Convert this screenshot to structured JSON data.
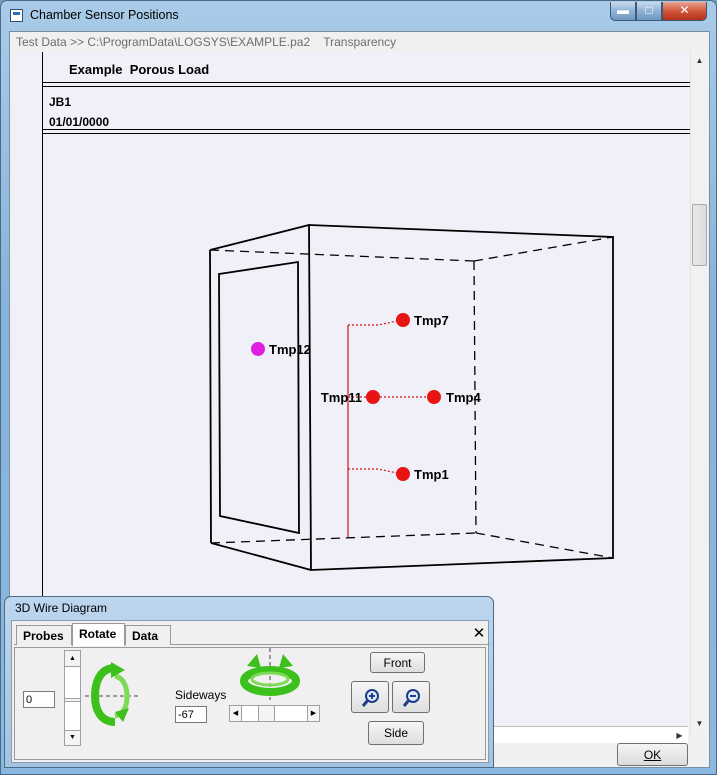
{
  "window": {
    "title": "Chamber Sensor Positions",
    "minimize_glyph": "▬",
    "maximize_glyph": "□",
    "close_glyph": "✕"
  },
  "menubar": {
    "text": "Test Data >> C:\\ProgramData\\LOGSYS\\EXAMPLE.pa2    Transparency"
  },
  "header": {
    "title": "Example  Porous Load",
    "line1": "JB1",
    "line2": "01/01/0000"
  },
  "sensors": [
    {
      "label": "Tmp12",
      "color": "#e020e0"
    },
    {
      "label": "Tmp7",
      "color": "#e81414"
    },
    {
      "label": "Tmp11",
      "color": "#e81414"
    },
    {
      "label": "Tmp4",
      "color": "#e81414"
    },
    {
      "label": "Tmp1",
      "color": "#e81414"
    }
  ],
  "ok_button": {
    "label": "OK"
  },
  "child_window": {
    "title": "3D Wire Diagram",
    "tabs": [
      {
        "label": "Probes",
        "active": false
      },
      {
        "label": "Rotate",
        "active": true
      },
      {
        "label": "Data",
        "active": false
      }
    ],
    "close_glyph": "✕",
    "vertical_value": "0",
    "sideways_label": "Sideways",
    "sideways_value": "-67",
    "front_label": "Front",
    "side_label": "Side"
  },
  "icons": [
    "rotate-vertical-icon",
    "rotate-horizontal-icon",
    "zoom-in-icon",
    "zoom-out-icon"
  ],
  "colors": {
    "accent_green": "#3cc01c",
    "sensor_red": "#e81414",
    "sensor_magenta": "#e020e0"
  }
}
